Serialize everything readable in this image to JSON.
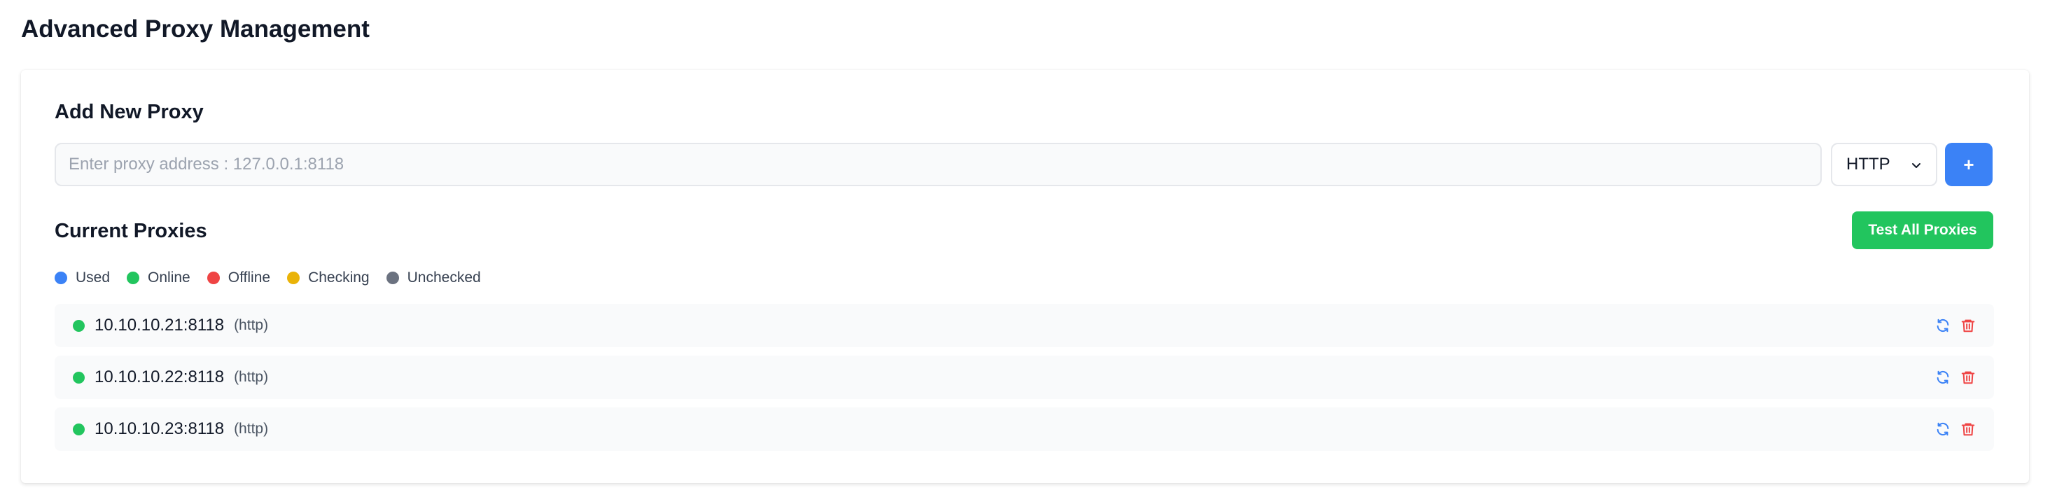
{
  "page": {
    "title": "Advanced Proxy Management"
  },
  "add_section": {
    "title": "Add New Proxy",
    "input_placeholder": "Enter proxy address : 127.0.0.1:8118",
    "input_value": "",
    "type_selected": "HTTP",
    "add_button_label": "+"
  },
  "current_section": {
    "title": "Current Proxies",
    "test_all_label": "Test All Proxies"
  },
  "legend": [
    {
      "label": "Used",
      "color": "#3b82f6"
    },
    {
      "label": "Online",
      "color": "#22c55e"
    },
    {
      "label": "Offline",
      "color": "#ef4444"
    },
    {
      "label": "Checking",
      "color": "#eab308"
    },
    {
      "label": "Unchecked",
      "color": "#6b7280"
    }
  ],
  "proxies": [
    {
      "address": "10.10.10.21:8118",
      "type": "(http)",
      "status": "Online",
      "status_color": "#22c55e",
      "refresh_icon": "refresh-icon",
      "delete_icon": "trash-icon"
    },
    {
      "address": "10.10.10.22:8118",
      "type": "(http)",
      "status": "Online",
      "status_color": "#22c55e",
      "refresh_icon": "refresh-icon",
      "delete_icon": "trash-icon"
    },
    {
      "address": "10.10.10.23:8118",
      "type": "(http)",
      "status": "Online",
      "status_color": "#22c55e",
      "refresh_icon": "refresh-icon",
      "delete_icon": "trash-icon"
    }
  ],
  "colors": {
    "accent_blue": "#3b82f6",
    "success_green": "#22c55e",
    "danger_red": "#ef4444"
  }
}
